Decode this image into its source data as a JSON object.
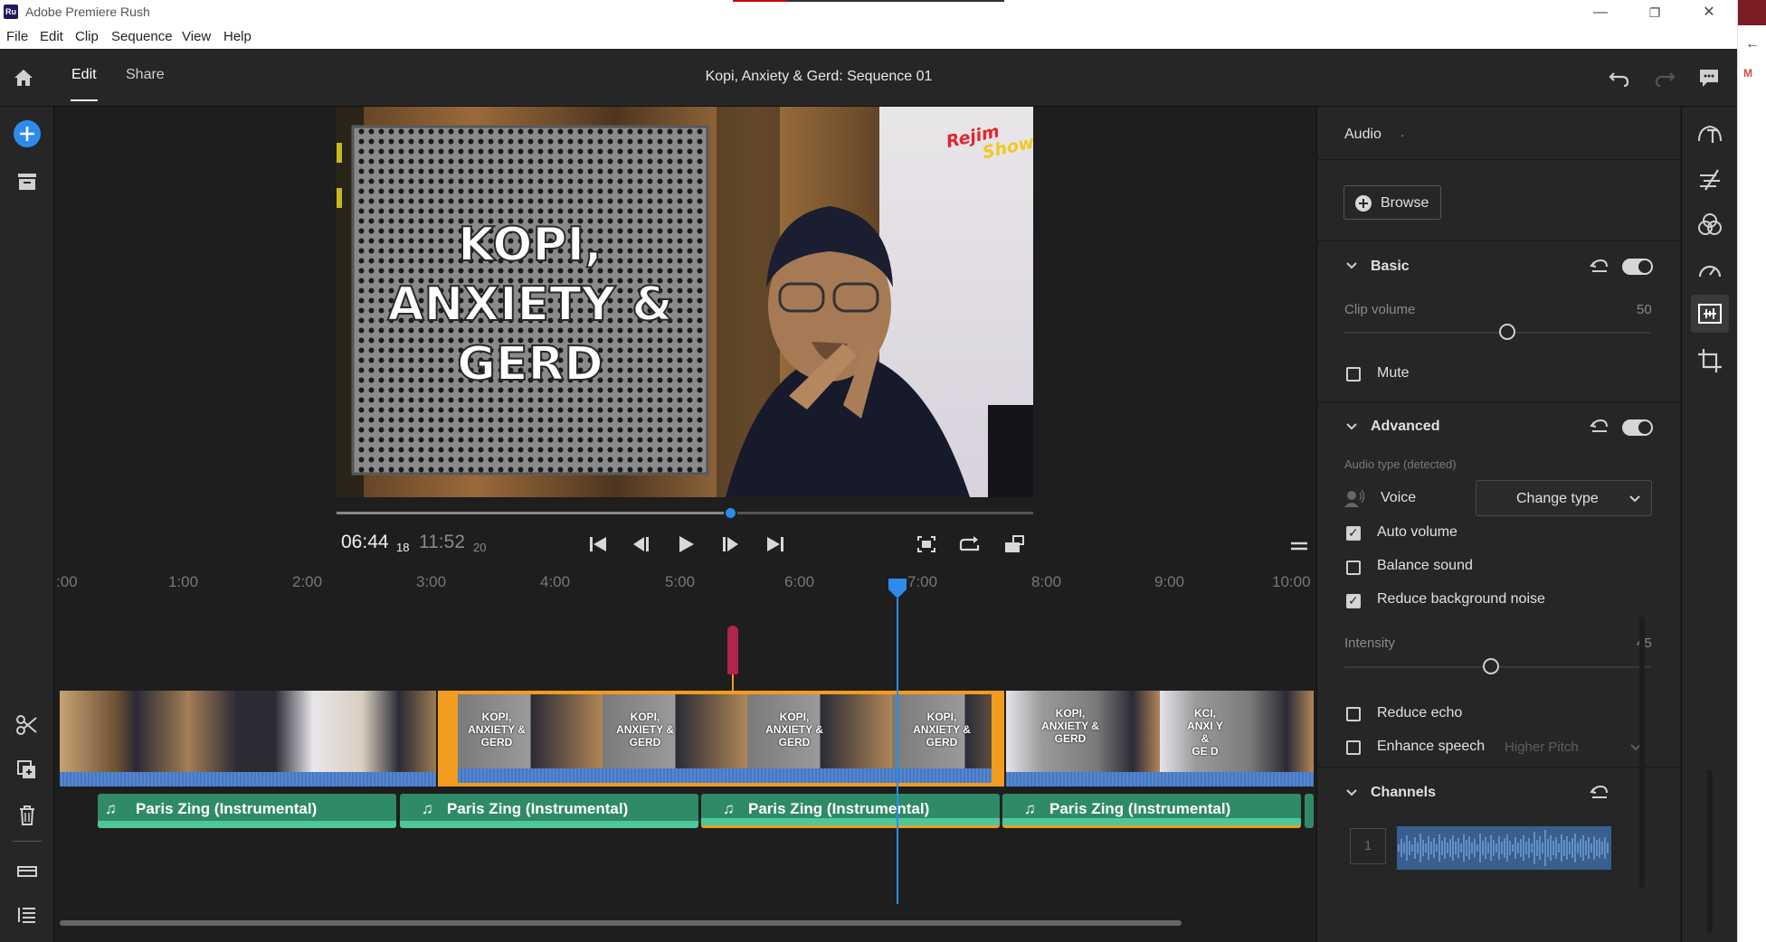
{
  "window": {
    "title": "Adobe Premiere Rush",
    "logo": "Ru"
  },
  "menu": [
    "File",
    "Edit",
    "Clip",
    "Sequence",
    "View",
    "Help"
  ],
  "topbar": {
    "tabs": [
      "Edit",
      "Share"
    ],
    "active_tab": "Edit",
    "sequence_title": "Kopi, Anxiety & Gerd: Sequence 01"
  },
  "preview": {
    "overlay_title_lines": [
      "KOPI,",
      "ANXIETY &",
      "GERD"
    ],
    "logo_text_1": "Rejim",
    "logo_text_2": "Show",
    "playhead_fraction": 0.565
  },
  "transport": {
    "current_time": "06:44",
    "current_frames": "18",
    "total_time": "11:52",
    "total_frames": "20"
  },
  "ruler": {
    "ticks": [
      ":00",
      "1:00",
      "2:00",
      "3:00",
      "4:00",
      "5:00",
      "6:00",
      "7:00",
      "8:00",
      "9:00",
      "10:00"
    ]
  },
  "timeline": {
    "thumb_text": [
      "KOPI,",
      "ANXIETY &",
      "GERD"
    ],
    "thumb_text_partial": [
      "KCI,",
      "ANXI Y &",
      "GE D"
    ],
    "audio_clips": [
      "Paris Zing (Instrumental)",
      "Paris Zing (Instrumental)",
      "Paris Zing (Instrumental)",
      "Paris Zing (Instrumental)"
    ]
  },
  "panel": {
    "title": "Audio",
    "title_suffix": ".",
    "browse_label": "Browse",
    "basic": {
      "title": "Basic",
      "clip_volume_label": "Clip volume",
      "clip_volume_value": "50",
      "mute_label": "Mute",
      "mute_checked": false
    },
    "advanced": {
      "title": "Advanced",
      "audio_type_label": "Audio type (detected)",
      "voice_label": "Voice",
      "change_type_label": "Change type",
      "auto_volume_label": "Auto volume",
      "auto_volume_checked": true,
      "balance_sound_label": "Balance sound",
      "balance_sound_checked": false,
      "reduce_noise_label": "Reduce background noise",
      "reduce_noise_checked": true,
      "intensity_label": "Intensity",
      "intensity_value": "45",
      "reduce_echo_label": "Reduce echo",
      "reduce_echo_checked": false,
      "enhance_speech_label": "Enhance speech",
      "enhance_speech_checked": false,
      "enhance_speech_option": "Higher Pitch"
    },
    "channels": {
      "title": "Channels",
      "channel_number": "1"
    }
  },
  "colors": {
    "accent_blue": "#2d8ceb",
    "selection_orange": "#f29c1f",
    "audio_green": "#2f8a68",
    "marker_magenta": "#b0244e"
  }
}
